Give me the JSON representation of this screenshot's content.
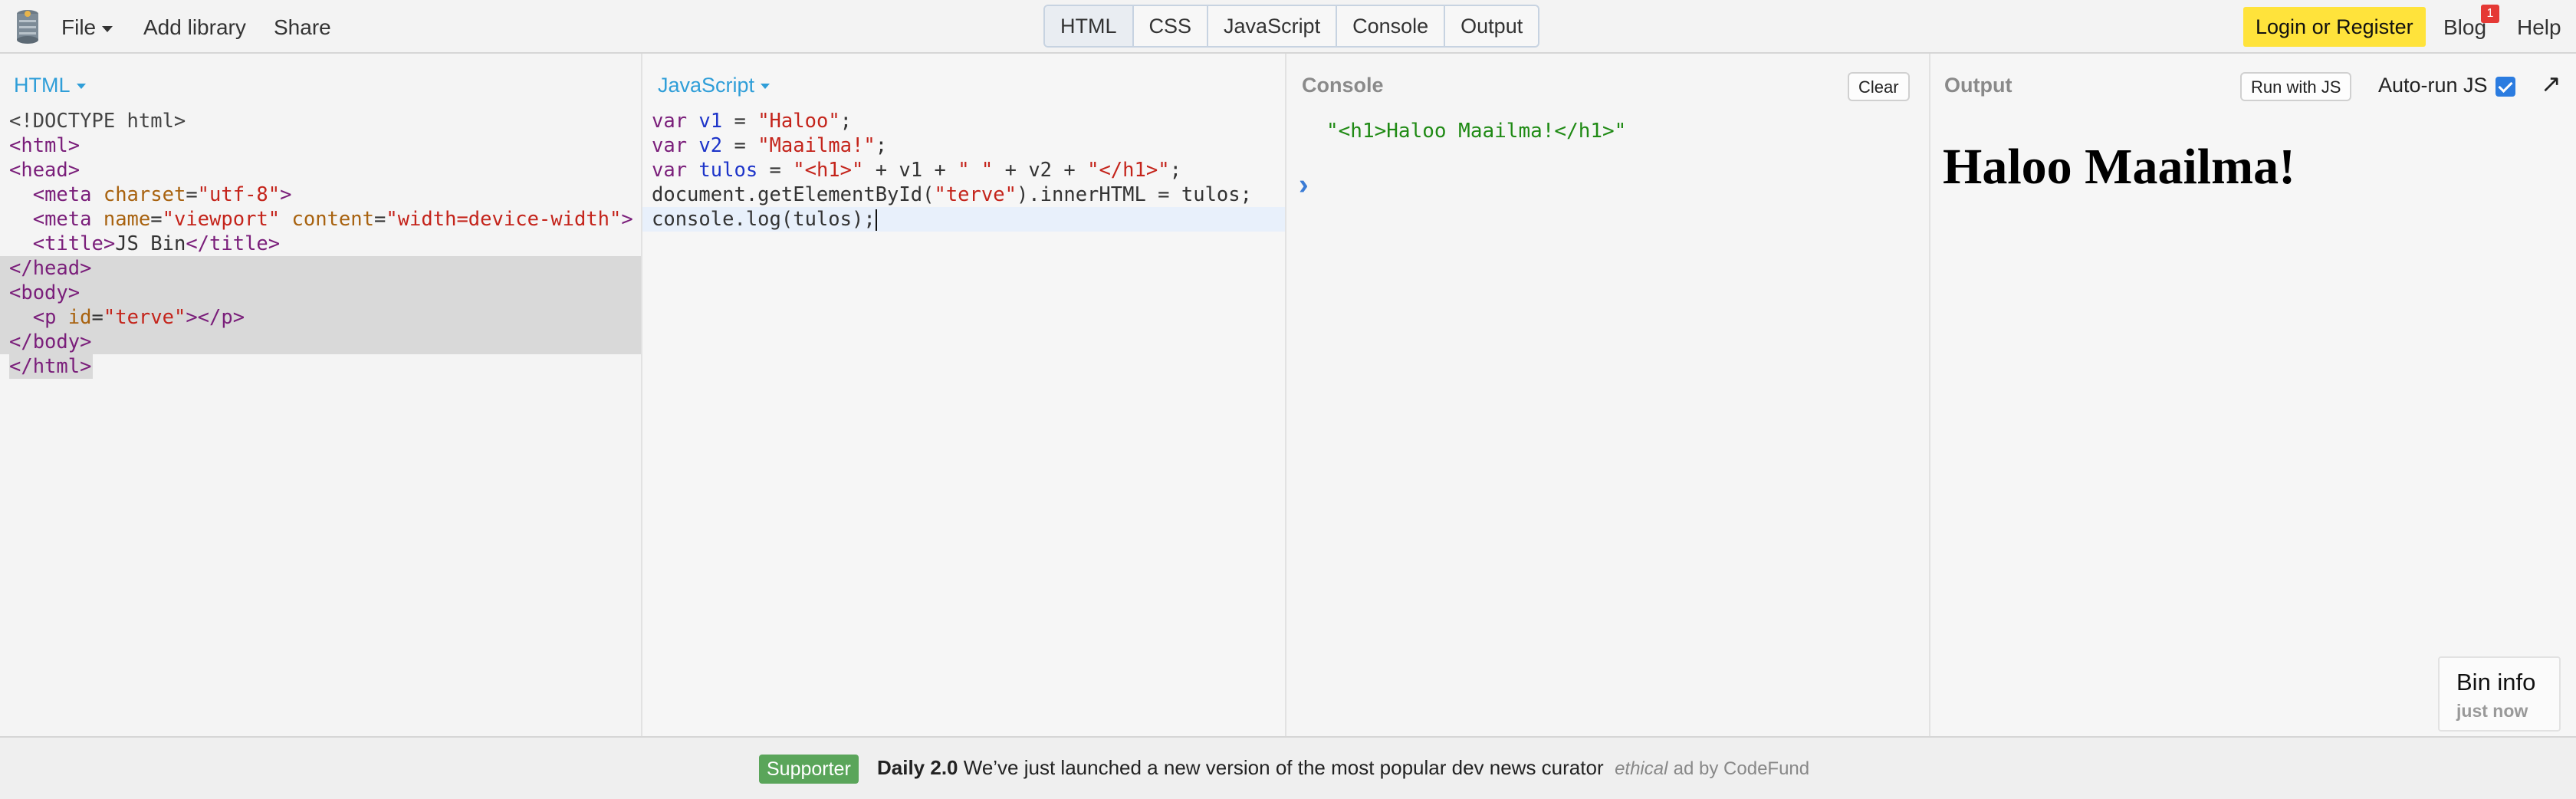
{
  "topbar": {
    "menu": {
      "file": "File",
      "add_library": "Add library",
      "share": "Share"
    },
    "tabs": [
      "HTML",
      "CSS",
      "JavaScript",
      "Console",
      "Output"
    ],
    "active_tab": "HTML",
    "login": "Login or Register",
    "blog": "Blog",
    "blog_badge": "1",
    "help": "Help"
  },
  "panels": {
    "html": {
      "label": "HTML"
    },
    "js": {
      "label": "JavaScript"
    },
    "console": {
      "label": "Console",
      "clear": "Clear",
      "output": "\"<h1>Haloo Maailma!</h1>\"",
      "prompt": "›"
    },
    "output": {
      "label": "Output",
      "run_button": "Run with JS",
      "autorun": "Auto-run JS",
      "autorun_checked": true,
      "popout": "↗",
      "rendered_heading": "Haloo Maailma!"
    }
  },
  "html_code": {
    "l1": "<!DOCTYPE html>",
    "l2": "<html>",
    "l3": "<head>",
    "l4": "  <meta charset=\"utf-8\">",
    "l5": "  <meta name=\"viewport\" content=\"width=device-width\">",
    "l6": "  <title>JS Bin</title>",
    "l7": "</head>",
    "l8": "<body>",
    "l9": "  <p id=\"terve\"></p>",
    "l10": "</body>",
    "l11": "</html>"
  },
  "js_code": {
    "l1": "var v1 = \"Haloo\";",
    "l2": "var v2 = \"Maailma!\";",
    "l3": "var tulos = \"<h1>\" + v1 + \" \" + v2 + \"</h1>\";",
    "l4": "document.getElementById(\"terve\").innerHTML = tulos;",
    "l5": "console.log(tulos);"
  },
  "bin_info": {
    "title": "Bin info",
    "time": "just now"
  },
  "footer": {
    "supporter": "Supporter",
    "ad_title": "Daily 2.0",
    "ad_text": "We’ve just launched a new version of the most popular dev news curator",
    "ethical": "ethical",
    "ad_by": "ad by CodeFund"
  },
  "colors": {
    "accent_blue": "#2f9ed8",
    "login_yellow": "#ffe33b",
    "supporter_green": "#5aa55a",
    "console_green": "#1f8a14",
    "badge_red": "#e53935"
  }
}
